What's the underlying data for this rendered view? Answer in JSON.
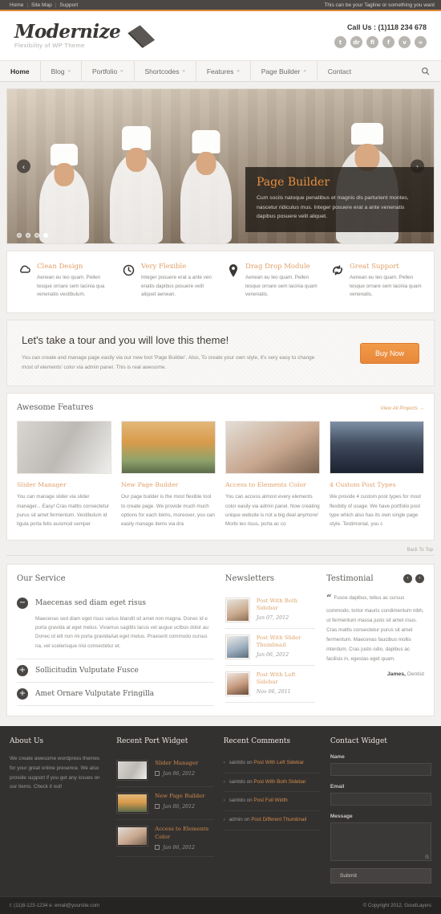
{
  "topbar": {
    "links": [
      "Home",
      "Site Map",
      "Support"
    ],
    "tagline": "This can be your Tagline or something you want"
  },
  "header": {
    "logo_name": "Modernize",
    "logo_tagline": "Flexibility of WP Theme",
    "call_us": "Call Us : (1)118 234 678",
    "socials": [
      {
        "name": "twitter-icon",
        "glyph": "t"
      },
      {
        "name": "dribbble-icon",
        "glyph": "dr"
      },
      {
        "name": "flickr-icon",
        "glyph": "fl"
      },
      {
        "name": "facebook-icon",
        "glyph": "f"
      },
      {
        "name": "vimeo-icon",
        "glyph": "v"
      },
      {
        "name": "rss-icon",
        "glyph": "∞"
      }
    ]
  },
  "nav": {
    "items": [
      {
        "label": "Home",
        "caret": "",
        "active": true
      },
      {
        "label": "Blog",
        "caret": "»",
        "active": false
      },
      {
        "label": "Portfolio",
        "caret": "»",
        "active": false
      },
      {
        "label": "Shortcodes",
        "caret": "»",
        "active": false
      },
      {
        "label": "Features",
        "caret": "»",
        "active": false
      },
      {
        "label": "Page Builder",
        "caret": "»",
        "active": false
      },
      {
        "label": "Contact",
        "caret": "",
        "active": false
      }
    ],
    "search_icon": "search-icon"
  },
  "slider": {
    "prev": "‹",
    "next": "›",
    "caption_title": "Page Builder",
    "caption_text": "Cum sociis natoque penatibus et magnis dis parturient montes, nascetur ridiculus mus. Integer posuere erat a ante venenatis dapibus posuere velit aliquet.",
    "dots": 4,
    "active_dot": 3
  },
  "features": [
    {
      "icon": "cloud-icon",
      "title": "Clean Design",
      "text": "Aenean eu leo quam. Pellen tesque ornare sem lacinia qua venenatis vestibulum."
    },
    {
      "icon": "clock-icon",
      "title": "Very Flexible",
      "text": "Integer posuere erat a ante ven enatis dapibus posuere velit aliquet aenean."
    },
    {
      "icon": "map-pin-icon",
      "title": "Drag Drop Module",
      "text": "Aenean eu leo quam. Pellen tesque ornare sem lacinia quam venenatis."
    },
    {
      "icon": "refresh-arrows-icon",
      "title": "Great Support",
      "text": "Aenean eu leo quam. Pellen tesque ornare sem lacinia quam venenatis."
    }
  ],
  "cta": {
    "heading": "Let's take a tour and you will love this theme!",
    "text": "You can create and manage page easily via our new tool 'Page Builder'. Also, To create your own style, it's very easy to change most of elements' color via admin panel. This is real awesome.",
    "button": "Buy Now"
  },
  "awesome": {
    "title": "Awesome Features",
    "view_all": "View All Projects →",
    "cards": [
      {
        "thumb": "dancer-photo",
        "title": "Slider Manager",
        "text": "You can manage slider via slider manager... Easy! Cras mattis consectetur purus sit amet fermentum. Vestibulum id ligula porta felis euismod semper"
      },
      {
        "thumb": "bus-photo",
        "title": "New Page Builder",
        "text": "Our page builder is the most flexible tool to create page. We provide much much options for each items, moreover, you can easily manage items via dra"
      },
      {
        "thumb": "couple-photo",
        "title": "Access to Elements Color",
        "text": "You can access almost every elements color easily via admin panel. Now creating unique website is not a big deal anymore! Morbi leo risus, porta ac co"
      },
      {
        "thumb": "city-photo",
        "title": "4 Custom Post Types",
        "text": "We provide 4 custom post types for most flexibity of usage. We have portfolio post type which also has its own single page style. Testimonial, you c"
      }
    ],
    "back_to_top": "Back To Top"
  },
  "service": {
    "title": "Our Service",
    "items": [
      {
        "icon": "minus-circle-icon",
        "title": "Maecenas sed diam eget risus",
        "open": true,
        "body": "Maecenas sed diam eget risus varius blandit sit amet non magna. Donec id e porta gravida at eget metus. Vivamus sagittis lacus vel augue uctbus dolor au Donec id elit non mi porta gravidaAat eget metus. Praesent commodo cursus na, vel scelerisque nisl consectetur et."
      },
      {
        "icon": "plus-circle-icon",
        "title": "Sollicitudin Vulputate Fusce",
        "open": false,
        "body": ""
      },
      {
        "icon": "plus-circle-icon",
        "title": "Amet Ornare Vulputate Fringilla",
        "open": false,
        "body": ""
      }
    ]
  },
  "newsletters": {
    "title": "Newsletters",
    "items": [
      {
        "thumb": "baby-photo",
        "title": "Post With Both Sidebar",
        "date": "Jan 07, 2012"
      },
      {
        "thumb": "family-photo",
        "title": "Post With Slider Thumbnail",
        "date": "Jan 06, 2012"
      },
      {
        "thumb": "couple-photo",
        "title": "Post With Left Sidebar",
        "date": "Nov 06, 2011"
      }
    ]
  },
  "testimonial": {
    "title": "Testimonial",
    "prev": "‹",
    "next": "›",
    "quote_mark": "“",
    "text": "Fusce dapibus, tellus ac cursus commodo, tortor mauris condimentum nibh, ut fermentum massa justo sit amet risus. Cras mattis consectetur purus sit amet fermentum. Maecenas faucibus mollis interdum. Cras justo odio, dapibus ac facilisis in, egestas eget quam.",
    "author_name": "James,",
    "author_role": "Dentist"
  },
  "footer": {
    "about": {
      "title": "About Us",
      "text": "We create awesome wordpress themes for your great online presence. We also provide support if you get any issues on our items. Check it out!"
    },
    "recent_port": {
      "title": "Recent Port Widget",
      "items": [
        {
          "thumb": "dancer-photo",
          "title": "Slider Manager",
          "date": "Jan 06, 2012"
        },
        {
          "thumb": "bus-photo",
          "title": "New Page Builder",
          "date": "Jan 06, 2012"
        },
        {
          "thumb": "couple-photo",
          "title": "Access to Elements Color",
          "date": "Jan 06, 2012"
        }
      ]
    },
    "recent_comments": {
      "title": "Recent Comments",
      "items": [
        {
          "author": "saintdo",
          "on": "on",
          "post": "Post With Left Sidebar"
        },
        {
          "author": "saintdo",
          "on": "on",
          "post": "Post With Both Sidebar"
        },
        {
          "author": "saintdo",
          "on": "on",
          "post": "Post Full Width"
        },
        {
          "author": "admin",
          "on": "on",
          "post": "Post Different Thumbnail"
        }
      ]
    },
    "contact": {
      "title": "Contact Widget",
      "name_label": "Name",
      "name_value": "",
      "email_label": "Email",
      "email_value": "",
      "message_label": "Message",
      "message_value": "",
      "submit": "Submit"
    }
  },
  "copybar": {
    "left": "t: (11)8-123-1234 e: email@yoursite.com",
    "right": "© Copyright 2012, GoodLayers"
  },
  "colors": {
    "accent": "#e8873a",
    "orange_title": "#e2a06a",
    "dark": "#333130",
    "topbar": "#4a4745"
  }
}
